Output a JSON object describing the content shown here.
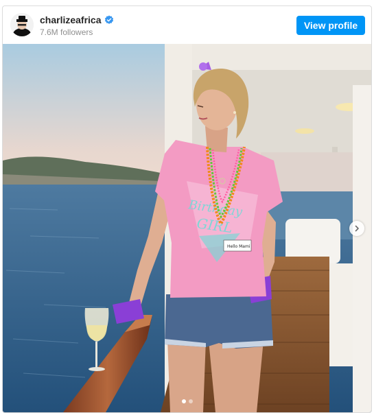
{
  "post": {
    "username": "charlizeafrica",
    "verified": true,
    "followers": "7.6M followers",
    "view_profile_label": "View profile"
  },
  "carousel": {
    "total_slides": 2,
    "active_slide": 1
  },
  "colors": {
    "accent": "#0095f6",
    "verified_badge": "#3897f0",
    "shirt": "#f39bc3",
    "gloves": "#8a3fd6",
    "sea": "#3a6a93"
  },
  "icons": {
    "verified": "verified-badge-icon",
    "next": "chevron-right-icon"
  },
  "image": {
    "shirt_print_line1": "Birthday",
    "shirt_print_line2": "GIRL",
    "name_tag": "Hello Mami"
  }
}
